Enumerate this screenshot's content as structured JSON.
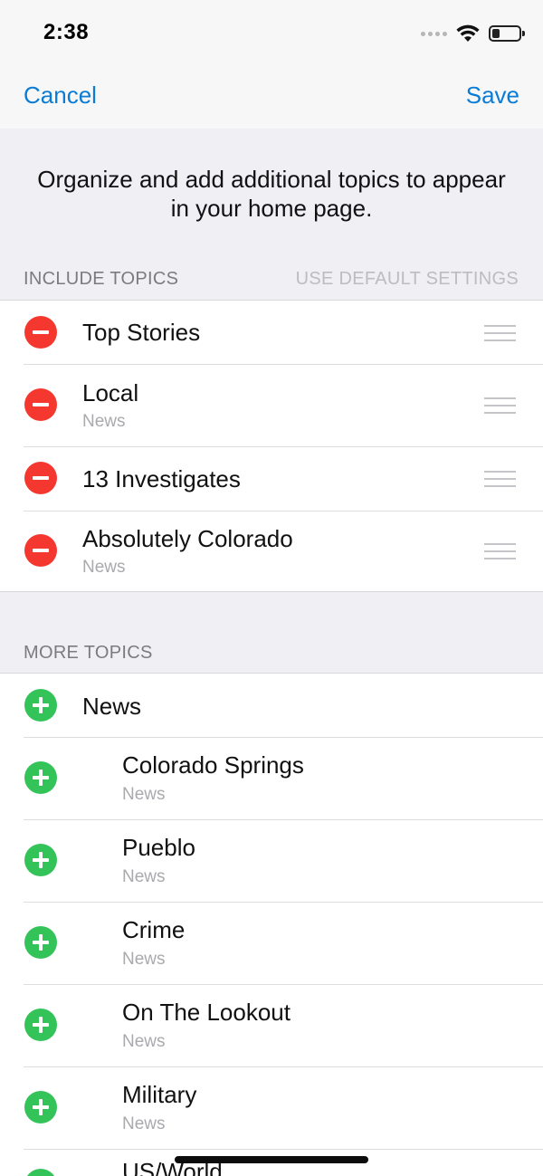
{
  "status_bar": {
    "time": "2:38"
  },
  "nav": {
    "cancel_label": "Cancel",
    "save_label": "Save"
  },
  "intro_text": "Organize and add additional topics to appear in your home page.",
  "include_section": {
    "header": "INCLUDE TOPICS",
    "action": "USE DEFAULT SETTINGS",
    "items": [
      {
        "title": "Top Stories",
        "subtitle": ""
      },
      {
        "title": "Local",
        "subtitle": "News"
      },
      {
        "title": "13 Investigates",
        "subtitle": ""
      },
      {
        "title": "Absolutely Colorado",
        "subtitle": "News"
      }
    ]
  },
  "more_section": {
    "header": "MORE TOPICS",
    "items": [
      {
        "title": "News",
        "subtitle": ""
      },
      {
        "title": "Colorado Springs",
        "subtitle": "News"
      },
      {
        "title": "Pueblo",
        "subtitle": "News"
      },
      {
        "title": "Crime",
        "subtitle": "News"
      },
      {
        "title": "On The Lookout",
        "subtitle": "News"
      },
      {
        "title": "Military",
        "subtitle": "News"
      },
      {
        "title": "US/World",
        "subtitle": ""
      }
    ]
  },
  "colors": {
    "accent": "#0a7cd6",
    "remove": "#f4372f",
    "add": "#34c359",
    "background": "#efeff4"
  },
  "icons": {
    "remove": "minus-circle-icon",
    "add": "plus-circle-icon",
    "reorder": "drag-handle-icon",
    "wifi": "wifi-icon",
    "battery": "battery-icon"
  }
}
